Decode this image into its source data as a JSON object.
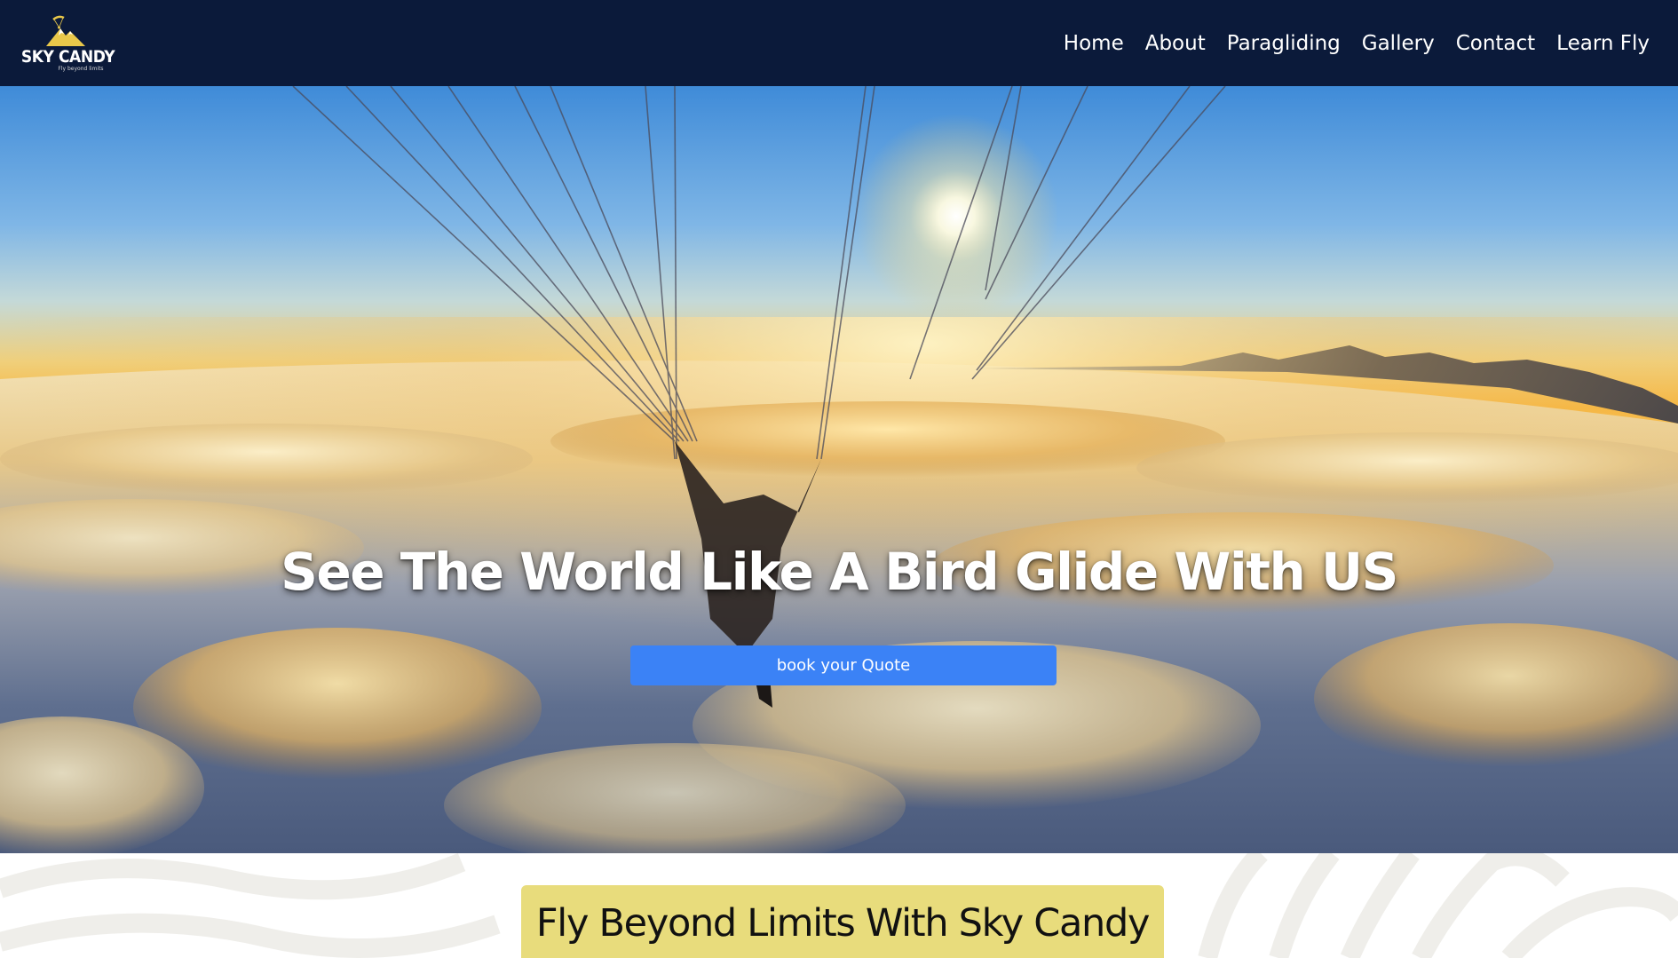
{
  "brand": {
    "name": "SKY CANDY",
    "tagline": "Fly beyond limits"
  },
  "nav": {
    "items": [
      {
        "label": "Home"
      },
      {
        "label": "About"
      },
      {
        "label": "Paragliding"
      },
      {
        "label": "Gallery"
      },
      {
        "label": "Contact"
      },
      {
        "label": "Learn Fly"
      }
    ]
  },
  "hero": {
    "title": "See The World Like A Bird Glide With US",
    "cta_label": "book your Quote"
  },
  "intro": {
    "title": "Fly Beyond Limits With Sky Candy"
  },
  "colors": {
    "navbar_bg": "#0b1a3a",
    "cta_bg": "#3b82f6",
    "banner_bg": "#e8dc7c",
    "logo_accent": "#e9c84a"
  },
  "icons": {
    "logo": "paraglider-mountain-logo"
  }
}
